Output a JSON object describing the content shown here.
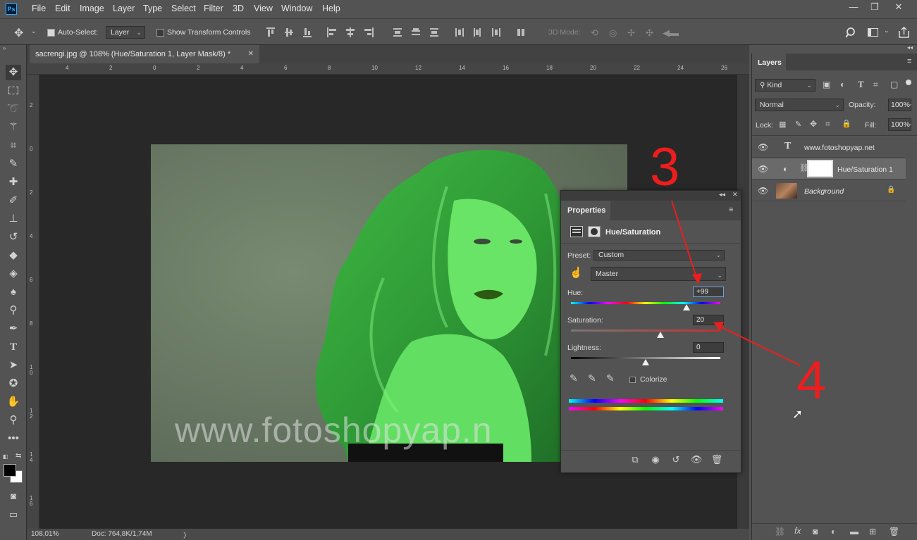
{
  "menubar": {
    "logo": "Ps",
    "items": [
      "File",
      "Edit",
      "Image",
      "Layer",
      "Type",
      "Select",
      "Filter",
      "3D",
      "View",
      "Window",
      "Help"
    ],
    "window_controls": [
      "—",
      "❐",
      "✕"
    ]
  },
  "options": {
    "auto_select_label": "Auto-Select:",
    "auto_select_value": "Layer",
    "show_transform_label": "Show Transform Controls",
    "mode_3d_label": "3D Mode:"
  },
  "document": {
    "tab_title": "sacrengi.jpg @ 108% (Hue/Saturation 1, Layer Mask/8) *",
    "tab_close": "✕",
    "watermark": "www.fotoshopyap.n",
    "ruler_top": [
      "4",
      "2",
      "0",
      "2",
      "4",
      "6",
      "8",
      "10",
      "12",
      "14",
      "16",
      "18",
      "20",
      "22",
      "24",
      "26"
    ],
    "ruler_left": [
      "2",
      "0",
      "2",
      "4",
      "6",
      "8",
      "1\n0",
      "1\n2",
      "1\n4",
      "1\n6"
    ]
  },
  "status": {
    "zoom": "108,01%",
    "doc": "Doc: 764,8K/1,74M",
    "arrow": "〉"
  },
  "properties": {
    "tab": "Properties",
    "title": "Hue/Saturation",
    "preset_label": "Preset:",
    "preset_value": "Custom",
    "channel_value": "Master",
    "hue_label": "Hue:",
    "hue_value": "+99",
    "hue_level": 99,
    "saturation_label": "Saturation:",
    "saturation_value": "20",
    "saturation_level": 20,
    "lightness_label": "Lightness:",
    "lightness_value": "0",
    "lightness_level": 0,
    "colorize_label": "Colorize"
  },
  "layers": {
    "tab": "Layers",
    "kind_label": "Kind",
    "blend_mode": "Normal",
    "opacity_label": "Opacity:",
    "opacity_value": "100%",
    "lock_label": "Lock:",
    "fill_label": "Fill:",
    "fill_value": "100%",
    "items": [
      {
        "name": "www.fotoshopyap.net",
        "type": "text-layer"
      },
      {
        "name": "Hue/Saturation 1",
        "type": "adjustment-layer"
      },
      {
        "name": "Background",
        "type": "image-layer"
      }
    ]
  },
  "annotations": {
    "number_3": "3",
    "number_4": "4",
    "arrow_color": "#ee1d1d"
  },
  "colors": {
    "panel": "#535353",
    "canvas": "#282828",
    "accent_green": "#4fcf4a"
  }
}
